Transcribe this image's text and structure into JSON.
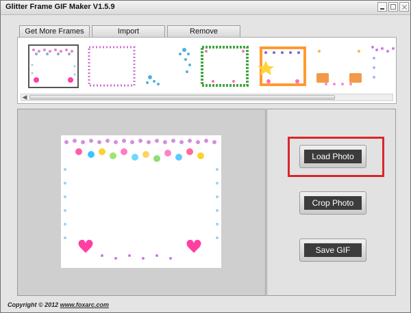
{
  "window": {
    "title": "Glitter Frame GIF Maker V1.5.9"
  },
  "tabs": [
    "Get More Frames",
    "Import",
    "Remove"
  ],
  "buttons": {
    "load": "Load Photo",
    "crop": "Crop Photo",
    "save": "Save GIF"
  },
  "footer": {
    "copyright": "Copyright © 2012",
    "link": "www.foxarc.com"
  },
  "colors": {
    "highlight": "#d9262b",
    "button_face": "#3c3c3c"
  }
}
